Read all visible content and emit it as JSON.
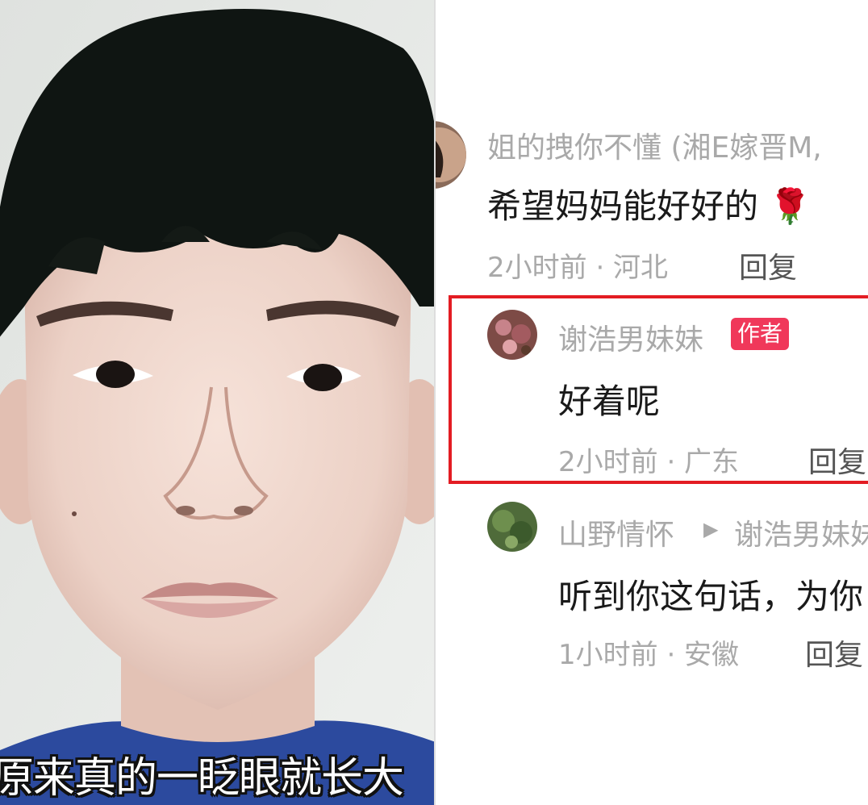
{
  "photo": {
    "subtitle": "原来真的一眨眼就长大"
  },
  "comments": [
    {
      "username": "姐的拽你不懂 (湘E嫁晋M,",
      "text": "希望妈妈能好好的 🌹",
      "meta": "2小时前 · 河北",
      "reply": "回复"
    },
    {
      "username": "谢浩男妹妹",
      "badge": "作者",
      "text": "好着呢",
      "meta": "2小时前 · 广东",
      "reply": "回复",
      "highlighted": true
    },
    {
      "username": "山野情怀",
      "arrow": "▶",
      "reply_to": "谢浩男妹妹",
      "text": "听到你这句话，为你",
      "meta": "1小时前 · 安徽",
      "reply": "回复"
    }
  ],
  "colors": {
    "highlight_border": "#e31c23",
    "author_badge": "#f0385a",
    "meta_text": "#a9a9a9"
  }
}
